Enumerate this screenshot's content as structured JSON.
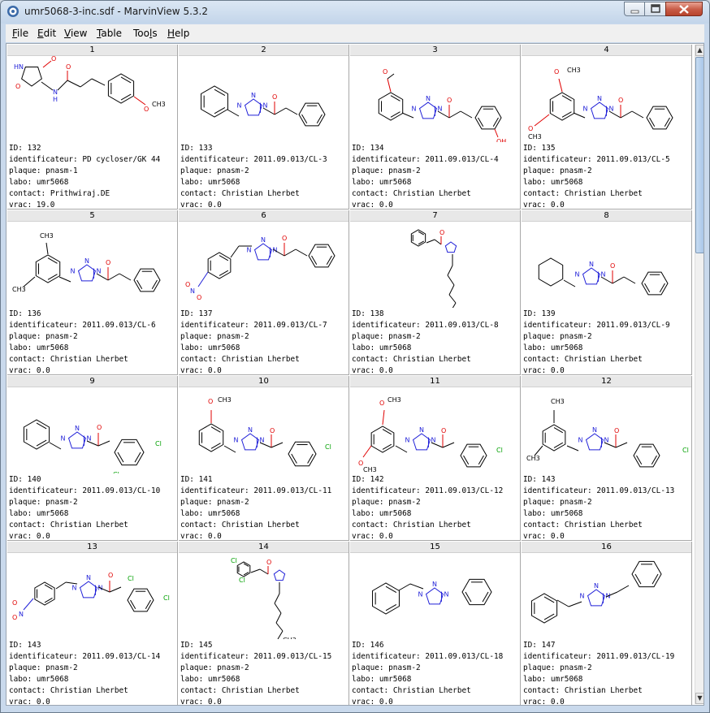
{
  "window": {
    "title": "umr5068-3-inc.sdf - MarvinView 5.3.2"
  },
  "menu": [
    "File",
    "Edit",
    "View",
    "Table",
    "Tools",
    "Help"
  ],
  "menu_mnemonics": [
    "F",
    "E",
    "V",
    "T",
    "l",
    "H"
  ],
  "cells": [
    {
      "num": "1",
      "id": "132",
      "ident": "PD cycloser/GK 44",
      "plaque": "pnasm-1",
      "labo": "umr5068",
      "contact": "Prithwiraj.DE",
      "vrac": "19.0"
    },
    {
      "num": "2",
      "id": "133",
      "ident": "2011.09.013/CL-3",
      "plaque": "pnasm-2",
      "labo": "umr5068",
      "contact": "Christian Lherbet",
      "vrac": "0.0"
    },
    {
      "num": "3",
      "id": "134",
      "ident": "2011.09.013/CL-4",
      "plaque": "pnasm-2",
      "labo": "umr5068",
      "contact": "Christian Lherbet",
      "vrac": "0.0"
    },
    {
      "num": "4",
      "id": "135",
      "ident": "2011.09.013/CL-5",
      "plaque": "pnasm-2",
      "labo": "umr5068",
      "contact": "Christian Lherbet",
      "vrac": "0.0"
    },
    {
      "num": "5",
      "id": "136",
      "ident": "2011.09.013/CL-6",
      "plaque": "pnasm-2",
      "labo": "umr5068",
      "contact": "Christian Lherbet",
      "vrac": "0.0"
    },
    {
      "num": "6",
      "id": "137",
      "ident": "2011.09.013/CL-7",
      "plaque": "pnasm-2",
      "labo": "umr5068",
      "contact": "Christian Lherbet",
      "vrac": "0.0"
    },
    {
      "num": "7",
      "id": "138",
      "ident": "2011.09.013/CL-8",
      "plaque": "pnasm-2",
      "labo": "umr5068",
      "contact": "Christian Lherbet",
      "vrac": "0.0"
    },
    {
      "num": "8",
      "id": "139",
      "ident": "2011.09.013/CL-9",
      "plaque": "pnasm-2",
      "labo": "umr5068",
      "contact": "Christian Lherbet",
      "vrac": "0.0"
    },
    {
      "num": "9",
      "id": "140",
      "ident": "2011.09.013/CL-10",
      "plaque": "pnasm-2",
      "labo": "umr5068",
      "contact": "Christian Lherbet",
      "vrac": "0.0"
    },
    {
      "num": "10",
      "id": "141",
      "ident": "2011.09.013/CL-11",
      "plaque": "pnasm-2",
      "labo": "umr5068",
      "contact": "Christian Lherbet",
      "vrac": "0.0"
    },
    {
      "num": "11",
      "id": "142",
      "ident": "2011.09.013/CL-12",
      "plaque": "pnasm-2",
      "labo": "umr5068",
      "contact": "Christian Lherbet",
      "vrac": "0.0"
    },
    {
      "num": "12",
      "id": "143",
      "ident": "2011.09.013/CL-13",
      "plaque": "pnasm-2",
      "labo": "umr5068",
      "contact": "Christian Lherbet",
      "vrac": "0.0"
    },
    {
      "num": "13",
      "id": "143",
      "ident": "2011.09.013/CL-14",
      "plaque": "pnasm-2",
      "labo": "umr5068",
      "contact": "Christian Lherbet",
      "vrac": "0.0"
    },
    {
      "num": "14",
      "id": "145",
      "ident": "2011.09.013/CL-15",
      "plaque": "pnasm-2",
      "labo": "umr5068",
      "contact": "Christian Lherbet",
      "vrac": "0.0"
    },
    {
      "num": "15",
      "id": "146",
      "ident": "2011.09.013/CL-18",
      "plaque": "pnasm-2",
      "labo": "umr5068",
      "contact": "Christian Lherbet",
      "vrac": "0.0"
    },
    {
      "num": "16",
      "id": "147",
      "ident": "2011.09.013/CL-19",
      "plaque": "pnasm-2",
      "labo": "umr5068",
      "contact": "Christian Lherbet",
      "vrac": "0.0"
    }
  ],
  "field_labels": {
    "id": "ID: ",
    "ident": "identificateur: ",
    "plaque": "plaque: ",
    "labo": "labo: ",
    "contact": "contact: ",
    "vrac": "vrac: "
  },
  "atom_labels": {
    "O": "O",
    "N": "N",
    "H": "H",
    "HN": "HN",
    "CH3": "CH3",
    "OH": "OH",
    "Cl": "Cl",
    "NO2": "N",
    "plus": "+",
    "minus": "-"
  },
  "colors": {
    "nitrogen": "#2020d8",
    "oxygen": "#e00000",
    "chlorine": "#00a000",
    "bond": "#000000",
    "header": "#e8e8e8"
  },
  "icons": {
    "app": "marvin-app-icon",
    "minimize": "minimize-icon",
    "maximize": "maximize-icon",
    "close": "close-icon",
    "scroll_up": "scroll-up-arrow-icon",
    "scroll_down": "scroll-down-arrow-icon"
  }
}
